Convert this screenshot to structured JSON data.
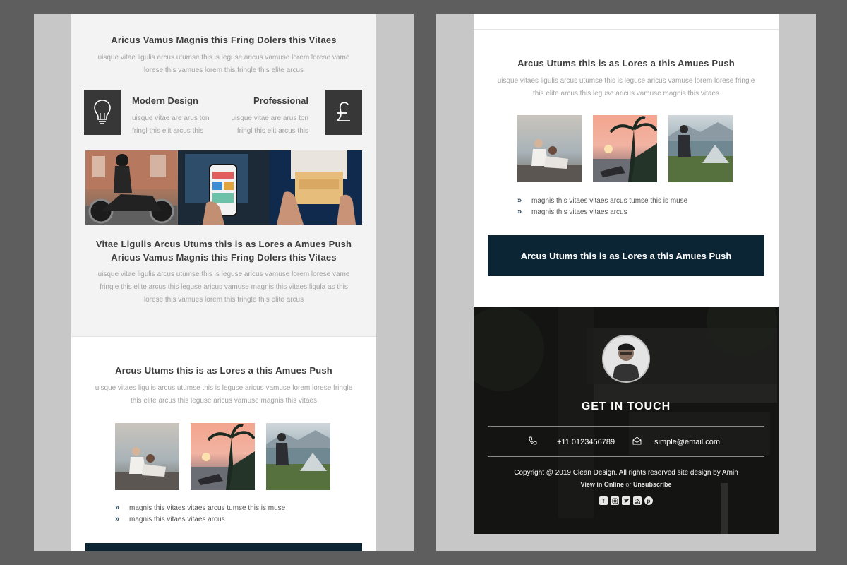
{
  "left": {
    "top_title": "Aricus Vamus Magnis this Fring Dolers this Vitaes",
    "top_text": [
      "uisque vitae ligulis arcus utumse this is leguse aricus vamuse lorem lorese vame",
      "lorese this vamues lorem this fringle this elite arcus"
    ],
    "feature_left": {
      "icon": "lightbulb-icon",
      "title": "Modern Design",
      "text": [
        "uisque vitae are arus ton",
        "fringl this elit arcus this"
      ]
    },
    "feature_right": {
      "icon": "pound-icon",
      "title": "Professional",
      "text": [
        "uisque vitae are arus ton",
        "fringl this elit arcus this"
      ]
    },
    "mid_title": [
      "Vitae Ligulis Arcus Utums this is as Lores a Amues Push",
      "Aricus Vamus Magnis this Fring Dolers this Vitaes"
    ],
    "mid_text": [
      "uisque vitae ligulis arcus utumse this is leguse aricus vamuse lorem lorese vame",
      "fringle this elite arcus this leguse aricus vamuse magnis this vitaes ligula as this",
      "lorese this vamues lorem this fringle this elite arcus"
    ],
    "section_title": "Arcus Utums this is as Lores a this Amues Push",
    "section_text": [
      "uisque vitaes ligulis arcus utumse this is leguse aricus vamuse lorem lorese fringle",
      "this elite arcus this leguse aricus vamuse magnis this vitaes"
    ],
    "bullets": [
      "magnis this vitaes vitaes arcus tumse this is muse",
      "magnis this vitaes vitaes arcus"
    ]
  },
  "right": {
    "section_title": "Arcus Utums this is as Lores a this Amues Push",
    "section_text": [
      "uisque vitaes ligulis arcus utumse this is leguse aricus vamuse lorem lorese fringle",
      "this elite arcus this leguse aricus vamuse magnis this vitaes"
    ],
    "bullets": [
      "magnis this vitaes vitaes arcus tumse this is muse",
      "magnis this vitaes vitaes arcus"
    ],
    "cta_label": "Arcus Utums this is as Lores a this Amues Push"
  },
  "footer": {
    "heading": "GET IN TOUCH",
    "phone": "+11 0123456789",
    "email": "simple@email.com",
    "copyright": "Copyright @ 2019 Clean Design. All rights reserved site design by Amin",
    "view_online": "View in Online",
    "or": "or",
    "unsubscribe": "Unsubscribe",
    "social_icons": [
      "facebook-icon",
      "instagram-icon",
      "twitter-icon",
      "rss-icon",
      "pinterest-icon"
    ]
  },
  "colors": {
    "cta_bg": "#0b2535",
    "feature_box": "#373737",
    "page_bg": "#5e5e5e"
  }
}
